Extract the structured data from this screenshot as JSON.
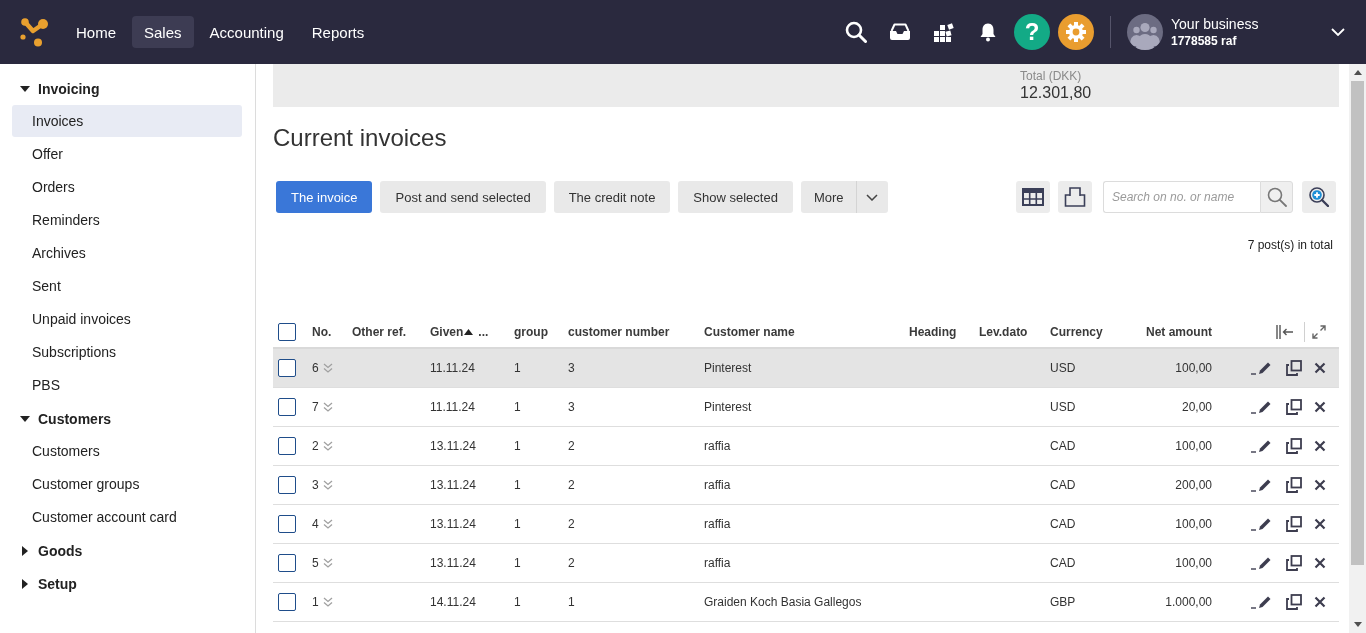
{
  "top_bar": {
    "nav": [
      {
        "label": "Home",
        "selected": false
      },
      {
        "label": "Sales",
        "selected": true
      },
      {
        "label": "Accounting",
        "selected": false
      },
      {
        "label": "Reports",
        "selected": false
      }
    ],
    "help_label": "?",
    "account": {
      "name": "Your business",
      "number": "1778585 raf"
    }
  },
  "sidebar": {
    "sections": [
      {
        "label": "Invoicing",
        "expanded": true,
        "children": [
          {
            "label": "Invoices",
            "selected": true
          },
          {
            "label": "Offer",
            "selected": false
          },
          {
            "label": "Orders",
            "selected": false
          },
          {
            "label": "Reminders",
            "selected": false
          },
          {
            "label": "Archives",
            "selected": false
          },
          {
            "label": "Sent",
            "selected": false
          },
          {
            "label": "Unpaid invoices",
            "selected": false
          },
          {
            "label": "Subscriptions",
            "selected": false
          },
          {
            "label": "PBS",
            "selected": false
          }
        ]
      },
      {
        "label": "Customers",
        "expanded": true,
        "children": [
          {
            "label": "Customers",
            "selected": false
          },
          {
            "label": "Customer groups",
            "selected": false
          },
          {
            "label": "Customer account card",
            "selected": false
          }
        ]
      },
      {
        "label": "Goods",
        "expanded": false
      },
      {
        "label": "Setup",
        "expanded": false
      }
    ]
  },
  "summary": {
    "label": "Total (DKK)",
    "value": "12.301,80"
  },
  "title": "Current invoices",
  "toolbar": {
    "buttons": [
      {
        "kind": "primary",
        "label": "The invoice"
      },
      {
        "kind": "plain",
        "label": "Post and send selected"
      },
      {
        "kind": "plain",
        "label": "The credit note"
      },
      {
        "kind": "plain",
        "label": "Show selected"
      },
      {
        "kind": "dropdown",
        "label": "More"
      }
    ],
    "search": {
      "placeholder": "Search on no. or name"
    }
  },
  "record_count": "7 post(s) in total",
  "table": {
    "select_all": {
      "checked": false
    },
    "columns": [
      {
        "label": "No.",
        "sorted": false
      },
      {
        "label": "Other ref.",
        "sorted": false
      },
      {
        "label": "Given",
        "sorted": true,
        "suffix": "..."
      },
      {
        "label": "group",
        "sorted": false
      },
      {
        "label": "customer number",
        "sorted": false
      },
      {
        "label": "Customer name",
        "sorted": false
      },
      {
        "label": "Heading",
        "sorted": false
      },
      {
        "label": "Lev.dato",
        "sorted": false
      },
      {
        "label": "Currency",
        "sorted": false
      },
      {
        "label": "Net amount",
        "sorted": false
      }
    ],
    "rows": [
      {
        "checked": false,
        "highlighted": true,
        "no": "6",
        "given": "11.11.24",
        "group": "1",
        "customer_number": "3",
        "customer_name": "Pinterest",
        "currency": "USD",
        "net_amount": "100,00"
      },
      {
        "checked": false,
        "highlighted": false,
        "no": "7",
        "given": "11.11.24",
        "group": "1",
        "customer_number": "3",
        "customer_name": "Pinterest",
        "currency": "USD",
        "net_amount": "20,00"
      },
      {
        "checked": false,
        "highlighted": false,
        "no": "2",
        "given": "13.11.24",
        "group": "1",
        "customer_number": "2",
        "customer_name": "raffia",
        "currency": "CAD",
        "net_amount": "100,00"
      },
      {
        "checked": false,
        "highlighted": false,
        "no": "3",
        "given": "13.11.24",
        "group": "1",
        "customer_number": "2",
        "customer_name": "raffia",
        "currency": "CAD",
        "net_amount": "200,00"
      },
      {
        "checked": false,
        "highlighted": false,
        "no": "4",
        "given": "13.11.24",
        "group": "1",
        "customer_number": "2",
        "customer_name": "raffia",
        "currency": "CAD",
        "net_amount": "100,00"
      },
      {
        "checked": false,
        "highlighted": false,
        "no": "5",
        "given": "13.11.24",
        "group": "1",
        "customer_number": "2",
        "customer_name": "raffia",
        "currency": "CAD",
        "net_amount": "100,00"
      },
      {
        "checked": false,
        "highlighted": false,
        "no": "1",
        "given": "14.11.24",
        "group": "1",
        "customer_number": "1",
        "customer_name": "Graiden Koch Basia Gallegos",
        "currency": "GBP",
        "net_amount": "1.000,00"
      }
    ]
  }
}
